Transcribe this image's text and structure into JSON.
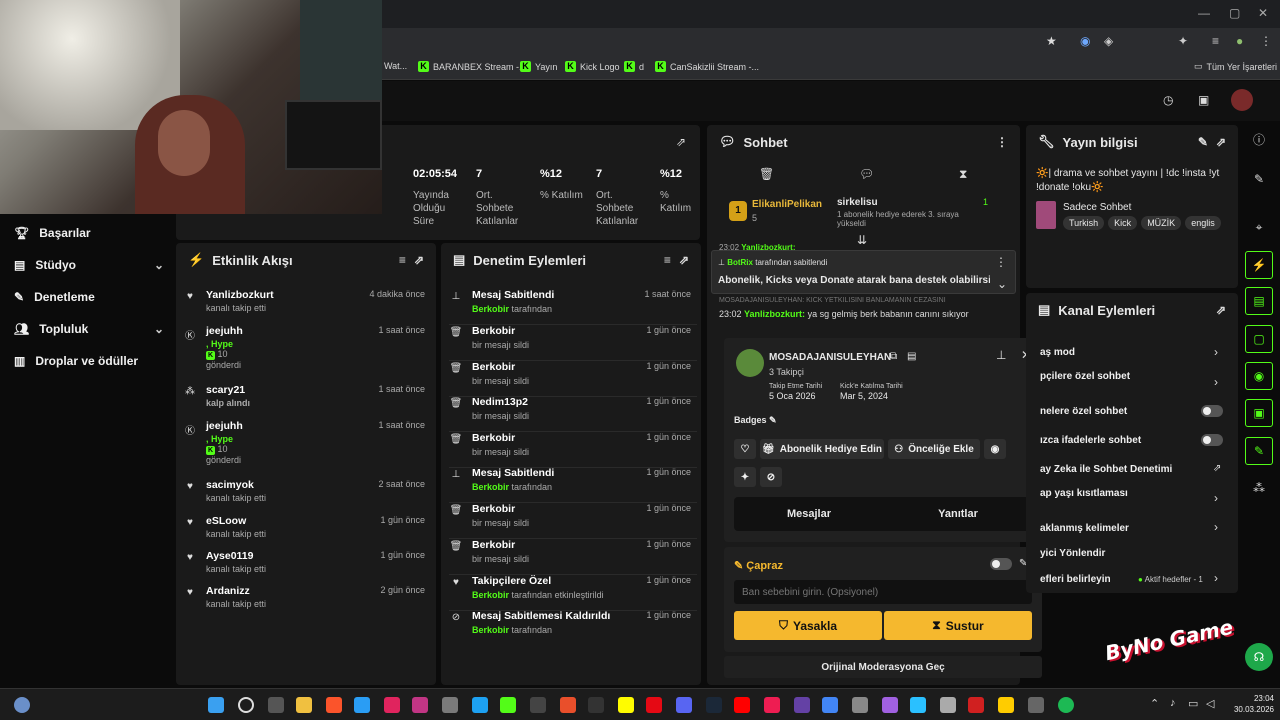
{
  "browser": {
    "bookmarks": [
      "Wat...",
      "BARANBEX Stream -...",
      "Yayın",
      "Kick Logo",
      "d",
      "CanSakizlii Stream -..."
    ],
    "bookmarks_folder": "Tüm Yer İşaretleri"
  },
  "sidebar": {
    "items": [
      {
        "icon": "trophy-icon",
        "label": "Başarılar"
      },
      {
        "icon": "studio-icon",
        "label": "Stüdyo"
      },
      {
        "icon": "wrench-icon",
        "label": "Denetleme"
      },
      {
        "icon": "community-icon",
        "label": "Topluluk"
      },
      {
        "icon": "drops-icon",
        "label": "Droplar ve ödüller"
      }
    ]
  },
  "stats": [
    {
      "value": "02:05:54",
      "label": "Yayında Olduğu Süre"
    },
    {
      "value": "7",
      "label": "Ort. Sohbete Katılanlar"
    },
    {
      "value": "%12",
      "label": "% Katılım"
    },
    {
      "value": "7",
      "label": "Ort. Sohbete Katılanlar"
    },
    {
      "value": "%12",
      "label": "% Katılım"
    }
  ],
  "activity": {
    "title": "Etkinlik Akışı",
    "items": [
      {
        "icon": "heart-icon",
        "name": "Yanlizbozkurt",
        "sub": "kanalı takip etti",
        "time": "4 dakika önce"
      },
      {
        "icon": "kick-icon",
        "name": "jeejuhh",
        "sub1": ", Hype",
        "sub2": "10",
        "sub3": "gönderdi",
        "time": "1 saat önce"
      },
      {
        "icon": "gift-icon",
        "name": "scary21",
        "sub": "kalp alındı",
        "time": "1 saat önce"
      },
      {
        "icon": "kick-icon",
        "name": "jeejuhh",
        "sub1": ", Hype",
        "sub2": "10",
        "sub3": "gönderdi",
        "time": "1 saat önce"
      },
      {
        "icon": "heart-icon",
        "name": "sacimyok",
        "sub": "kanalı takip etti",
        "time": "2 saat önce"
      },
      {
        "icon": "heart-icon",
        "name": "eSLoow",
        "sub": "kanalı takip etti",
        "time": "1 gün önce"
      },
      {
        "icon": "heart-icon",
        "name": "Ayse0119",
        "sub": "kanalı takip etti",
        "time": "1 gün önce"
      },
      {
        "icon": "heart-icon",
        "name": "Ardanizz",
        "sub": "kanalı takip etti",
        "time": "2 gün önce"
      }
    ]
  },
  "moderation": {
    "title": "Denetim Eylemleri",
    "items": [
      {
        "icon": "pin-icon",
        "name": "Mesaj Sabitlendi",
        "actor": "Berkobir",
        "sub": "tarafından",
        "time": "1 saat önce"
      },
      {
        "icon": "trash-icon",
        "name": "Berkobir",
        "sub": "bir mesajı sildi",
        "time": "1 gün önce"
      },
      {
        "icon": "trash-icon",
        "name": "Berkobir",
        "sub": "bir mesajı sildi",
        "time": "1 gün önce"
      },
      {
        "icon": "trash-icon",
        "name": "Nedim13p2",
        "sub": "bir mesajı sildi",
        "time": "1 gün önce"
      },
      {
        "icon": "trash-icon",
        "name": "Berkobir",
        "sub": "bir mesajı sildi",
        "time": "1 gün önce"
      },
      {
        "icon": "pin-icon",
        "name": "Mesaj Sabitlendi",
        "actor": "Berkobir",
        "sub": "tarafından",
        "time": "1 gün önce"
      },
      {
        "icon": "trash-icon",
        "name": "Berkobir",
        "sub": "bir mesajı sildi",
        "time": "1 gün önce"
      },
      {
        "icon": "trash-icon",
        "name": "Berkobir",
        "sub": "bir mesajı sildi",
        "time": "1 gün önce"
      },
      {
        "icon": "heart-icon",
        "name": "Takipçilere Özel",
        "actor": "Berkobir",
        "sub": "tarafından etkinleştirildi",
        "time": "1 gün önce"
      },
      {
        "icon": "unpin-icon",
        "name": "Mesaj Sabitlemesi Kaldırıldı",
        "actor": "Berkobir",
        "sub": "tarafından",
        "time": "1 gün önce"
      }
    ]
  },
  "chat": {
    "title": "Sohbet",
    "top_user": "ElikanliPelikan",
    "top_count": "5",
    "gift_user": "sirkelisu",
    "gift_text": "1 abonelik hediye ederek 3. sıraya yükseldi",
    "gift_num": "1",
    "msg1_time": "23:02",
    "msg1_user": "Yanlizbozkurt:",
    "pinned_by": "BotRix",
    "pinned_suffix": "tarafından sabitlendi",
    "pinned_text": "Abonelik, Kicks veya Donate atarak bana destek olabilirsin...",
    "cut_text": "MOSADAJANISULEYHAN: KICK YETKILISINI BANLAMANIN CEZASINI",
    "msg2_time": "23:02",
    "msg2_user": "Yanlizbozkurt:",
    "msg2_text": "ya sg gelmiş berk babanın canını sıkıyor"
  },
  "usercard": {
    "name": "MOSADAJANISULEYHAN",
    "followers": "3 Takipçi",
    "follow_label": "Takip Etme Tarihi",
    "follow_date": "5 Oca 2026",
    "join_label": "Kick'e Katılma Tarihi",
    "join_date": "Mar 5, 2024",
    "badges": "Badges",
    "gift_sub": "Abonelik Hediye Edin",
    "add_priority": "Önceliğe Ekle",
    "tab_messages": "Mesajlar",
    "tab_replies": "Yanıtlar"
  },
  "ban": {
    "title": "Çapraz",
    "placeholder": "Ban sebebini girin. (Opsiyonel)",
    "ban_btn": "Yasakla",
    "mute_btn": "Sustur",
    "switch": "Orijinal Moderasyona Geç"
  },
  "stream_info": {
    "title": "Yayın bilgisi",
    "text": "🔆| drama ve sohbet yayını | !dc !insta !yt !donate !oku🔆",
    "category": "Sadece Sohbet",
    "tags": [
      "Turkish",
      "Kick",
      "MÜZİK",
      "englis"
    ]
  },
  "channel_actions": {
    "title": "Kanal Eylemleri",
    "rows": [
      "aş mod",
      "pçilere özel sohbet",
      "nelere özel sohbet",
      "ızca ifadelerle sohbet",
      "ay Zeka ile Sohbet Denetimi",
      "ap yaşı kısıtlaması",
      "aklanmış kelimeler",
      "yici Yönlendir",
      "efleri belirleyin"
    ],
    "goals": "Aktif hedefler - 1"
  },
  "overlay_logo": "ByNo Game",
  "taskbar": {
    "time": "23:04",
    "date": "30.03.2026"
  }
}
